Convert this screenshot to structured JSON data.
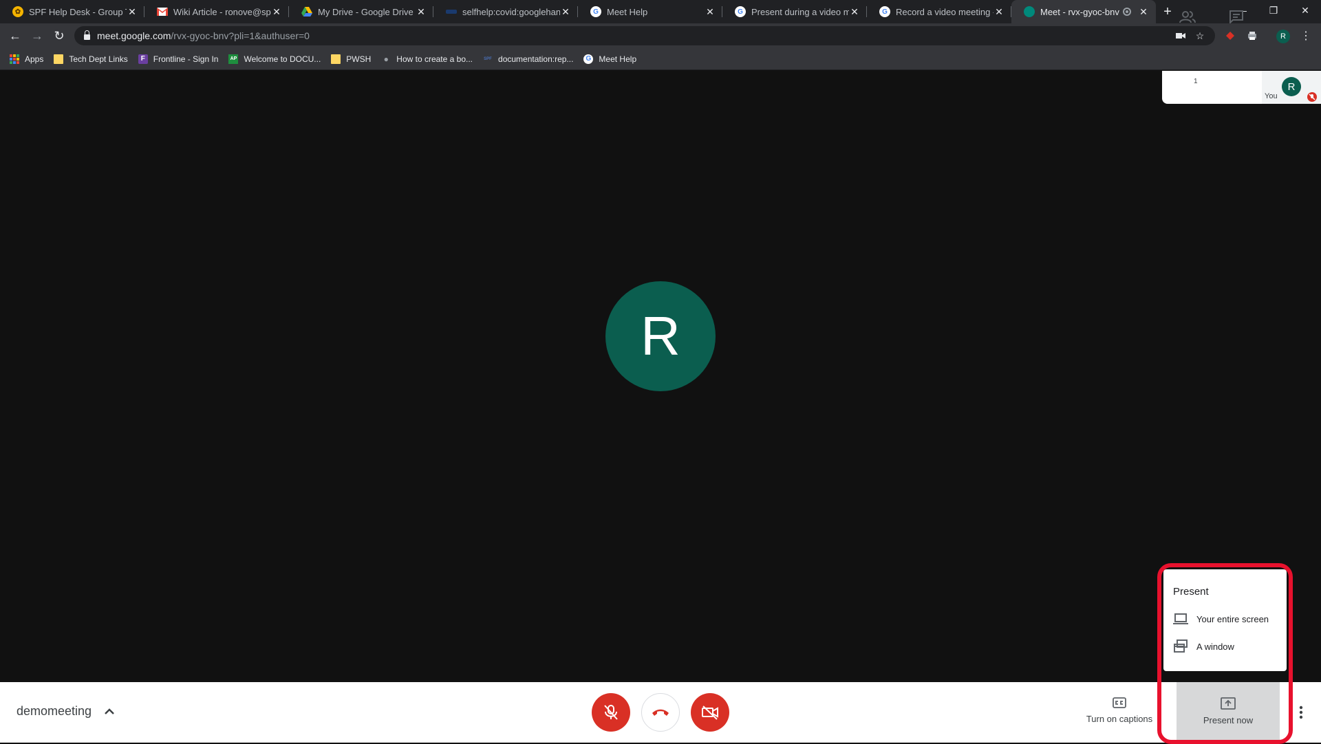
{
  "browser": {
    "tabs": [
      {
        "title": "SPF Help Desk - Group Tick",
        "icon_color": "#f4b400"
      },
      {
        "title": "Wiki Article - ronove@spfk",
        "icon_color": "#ea4335"
      },
      {
        "title": "My Drive - Google Drive",
        "icon_color": "#34a853"
      },
      {
        "title": "selfhelp:covid:googlehango",
        "icon_color": "#1a3a6e"
      },
      {
        "title": "Meet Help",
        "icon_color": "#ffffff"
      },
      {
        "title": "Present during a video mee",
        "icon_color": "#ffffff"
      },
      {
        "title": "Record a video meeting - M",
        "icon_color": "#ffffff"
      },
      {
        "title": "Meet - rvx-gyoc-bnv",
        "icon_color": "#00897b",
        "active": true
      }
    ],
    "url_host": "meet.google.com",
    "url_path": "/rvx-gyoc-bnv?pli=1&authuser=0",
    "profile_initial": "R",
    "bookmarks": [
      {
        "label": "Apps",
        "icon": "apps-grid-icon"
      },
      {
        "label": "Tech Dept Links",
        "icon": "folder-icon"
      },
      {
        "label": "Frontline - Sign In",
        "icon": "frontline-icon"
      },
      {
        "label": "Welcome to DOCU...",
        "icon": "docu-icon"
      },
      {
        "label": "PWSH",
        "icon": "folder-icon"
      },
      {
        "label": "How to create a bo...",
        "icon": "apple-icon"
      },
      {
        "label": "documentation:rep...",
        "icon": "spf-icon"
      },
      {
        "label": "Meet Help",
        "icon": "google-icon"
      }
    ]
  },
  "meet": {
    "main_avatar_initial": "R",
    "participant_count": "1",
    "self_initial": "R",
    "self_label": "You",
    "meeting_name": "demomeeting",
    "captions_label": "Turn on captions",
    "present_now_label": "Present now",
    "present_menu": {
      "title": "Present",
      "items": [
        {
          "label": "Your entire screen",
          "icon": "laptop-icon"
        },
        {
          "label": "A window",
          "icon": "window-icon"
        }
      ]
    }
  },
  "colors": {
    "avatar_green": "#0b5e4f",
    "call_red": "#d93025",
    "highlight_red": "#e8112d"
  }
}
